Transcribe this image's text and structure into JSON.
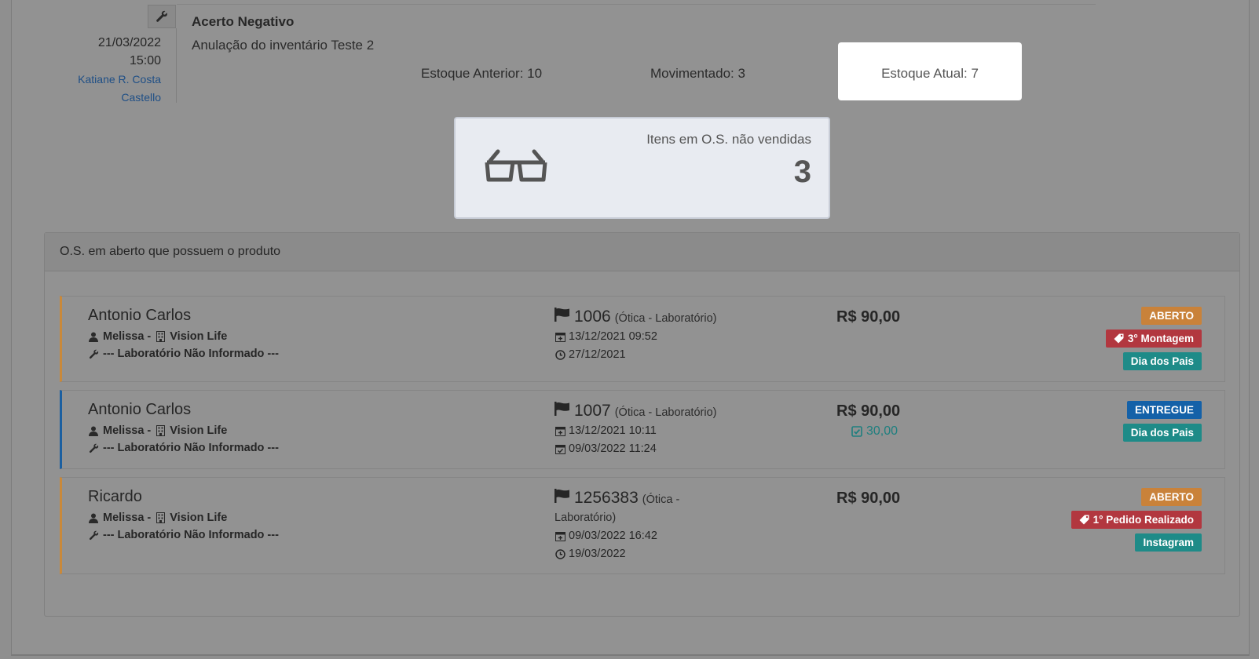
{
  "timeline": {
    "date": "21/03/2022",
    "time": "15:00",
    "user_line1": "Katiane R. Costa",
    "user_line2": "Castello",
    "title": "Acerto Negativo",
    "description": "Anulação do inventário Teste 2",
    "stock_previous": "Estoque Anterior: 10",
    "stock_moved": "Movimentado: 3",
    "stock_current": "Estoque Atual: 7",
    "icon": "wrench-icon"
  },
  "info_card": {
    "label": "Itens em O.S. não vendidas",
    "value": "3",
    "icon": "glasses-icon"
  },
  "panel": {
    "title": "O.S. em aberto que possuem o produto"
  },
  "orders": [
    {
      "client": "Antonio Carlos",
      "seller": "Melissa -",
      "store": "Vision Life",
      "lab": "--- Laboratório Não Informado ---",
      "number": "1006",
      "type": "(Ótica - Laboratório)",
      "date_created": "13/12/2021 09:52",
      "date_due": "27/12/2021",
      "price": "R$ 90,00",
      "badges": [
        "ABERTO",
        "3° Montagem",
        "Dia dos Pais"
      ]
    },
    {
      "client": "Antonio Carlos",
      "seller": "Melissa -",
      "store": "Vision Life",
      "lab": "--- Laboratório Não Informado ---",
      "number": "1007",
      "type": "(Ótica - Laboratório)",
      "date_created": "13/12/2021 10:11",
      "date_delivered": "09/03/2022 11:24",
      "price": "R$ 90,00",
      "paid": "30,00",
      "badges": [
        "ENTREGUE",
        "Dia dos Pais"
      ]
    },
    {
      "client": "Ricardo",
      "seller": "Melissa -",
      "store": "Vision Life",
      "lab": "--- Laboratório Não Informado ---",
      "number": "1256383",
      "type_line1": "(Ótica -",
      "type_line2": "Laboratório)",
      "date_created": "09/03/2022 16:42",
      "date_due": "19/03/2022",
      "price": "R$ 90,00",
      "badges": [
        "ABERTO",
        "1° Pedido Realizado",
        "Instagram"
      ]
    }
  ],
  "colors": {
    "aberto": "#c9823a",
    "entregue": "#1461a8",
    "tag_red": "#b2373f",
    "tag_teal": "#1e8b88"
  }
}
